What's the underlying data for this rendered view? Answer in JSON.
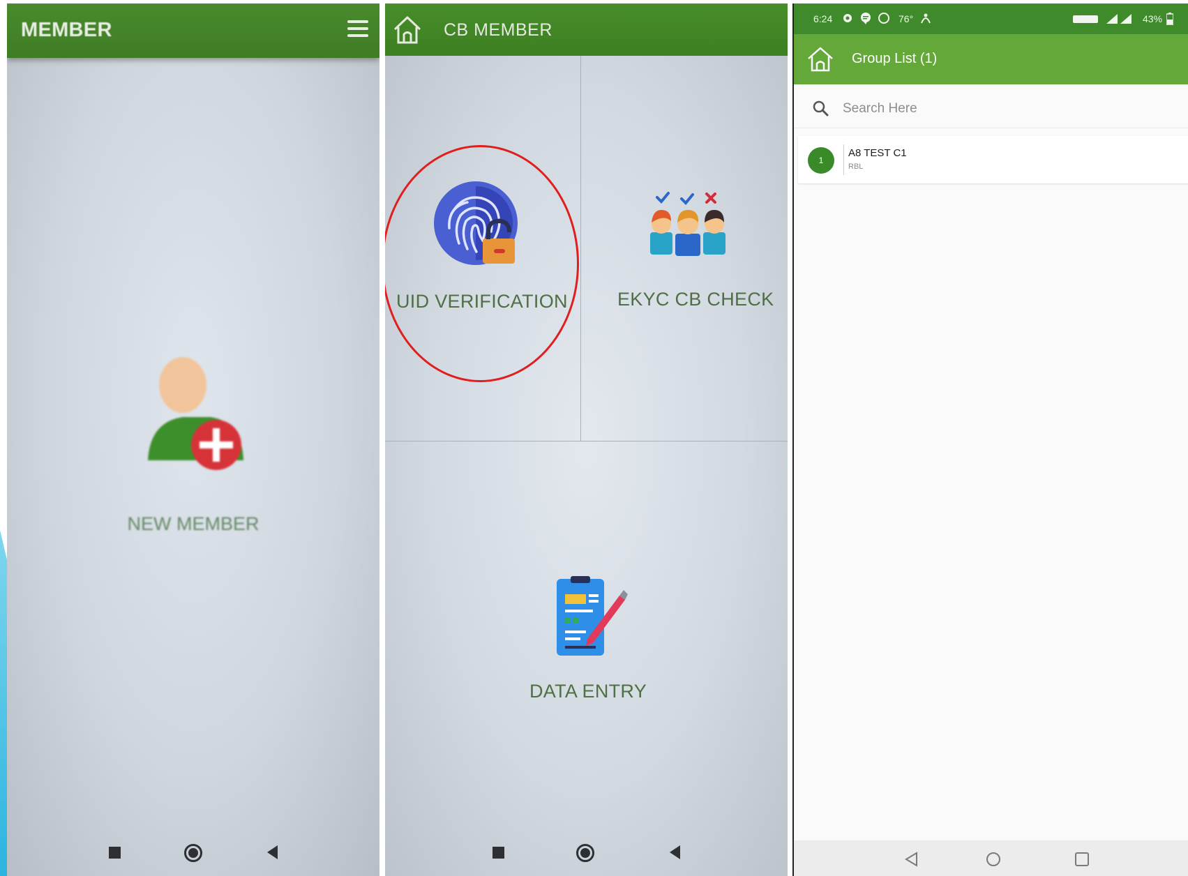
{
  "panel1": {
    "title": "MEMBER",
    "new_member_label": "NEW MEMBER"
  },
  "panel2": {
    "title": "CB MEMBER",
    "tiles": {
      "uid_verification": "UID VERIFICATION",
      "ekyc_cb_check": "EKYC CB CHECK",
      "data_entry": "DATA ENTRY"
    }
  },
  "panel3": {
    "status_bar": {
      "time": "6:24",
      "temperature": "76°",
      "battery": "43%"
    },
    "app_bar_title": "Group List (1)",
    "search_placeholder": "Search Here",
    "list": [
      {
        "index": "1",
        "name": "A8 TEST C1",
        "sub": "RBL"
      }
    ]
  },
  "colors": {
    "app_green": "#3f7d25",
    "list_header_green": "#64a83a",
    "label_green": "#4f6f44",
    "highlight_red": "#e01e1e"
  }
}
